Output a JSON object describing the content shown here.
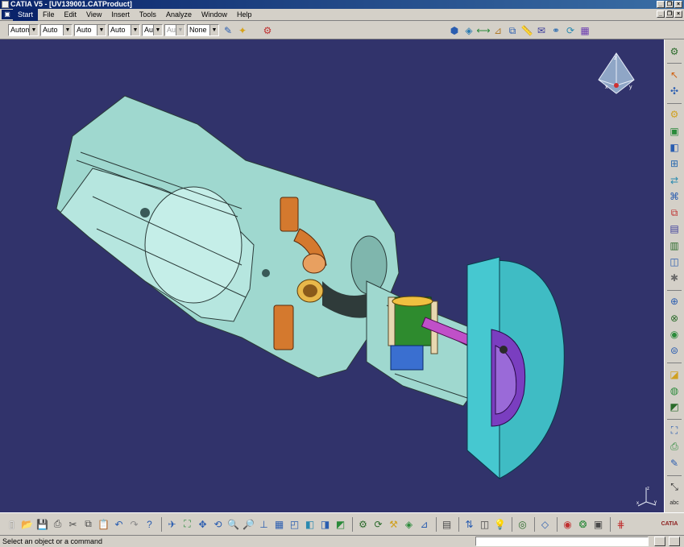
{
  "window": {
    "title": "CATIA V5 - [UV139001.CATProduct]"
  },
  "menu": {
    "items": [
      "Start",
      "File",
      "Edit",
      "View",
      "Insert",
      "Tools",
      "Analyze",
      "Window",
      "Help"
    ]
  },
  "toolbar": {
    "combos": [
      {
        "value": "Autome",
        "disabled": false
      },
      {
        "value": "Auto",
        "disabled": false
      },
      {
        "value": "Auto",
        "disabled": false
      },
      {
        "value": "Auto",
        "disabled": false
      },
      {
        "value": "Aut",
        "disabled": false
      },
      {
        "value": "Aut",
        "disabled": true
      },
      {
        "value": "None",
        "disabled": false
      }
    ]
  },
  "compass": {
    "axis_x": "x",
    "axis_y": "y",
    "axis_z": "z"
  },
  "axis_triad": {
    "x": "x",
    "y": "y",
    "z": "z"
  },
  "status": {
    "message": "Select an object or a command"
  },
  "logo": {
    "text": "CATIA"
  },
  "colors": {
    "viewport_bg": "#31336b",
    "part_body": "#9fd8cf",
    "part_edge": "#2a3a38",
    "copper": "#d4792e",
    "green": "#2e8b2e",
    "blue": "#3a6fd0",
    "magenta": "#c050c8",
    "cyan_disc": "#3fbcc4",
    "purple": "#7a3ec0"
  }
}
